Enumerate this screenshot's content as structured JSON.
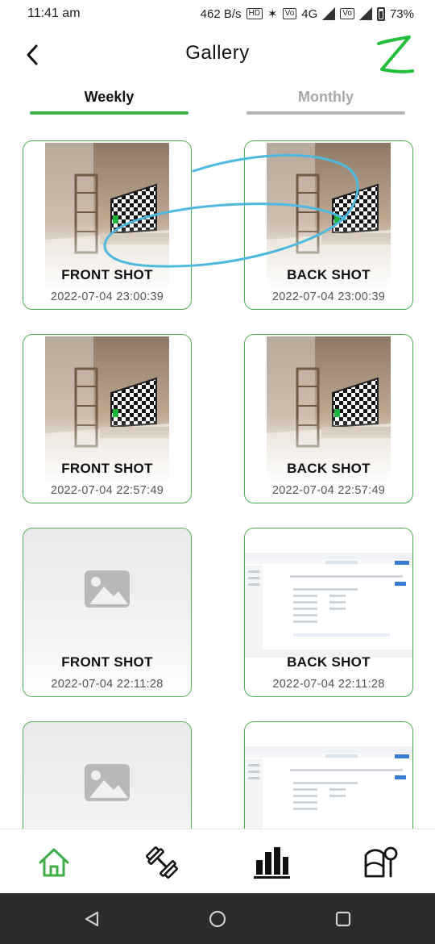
{
  "status": {
    "time": "11:41 am",
    "net_speed": "462 B/s",
    "battery": "73%",
    "network": "4G"
  },
  "header": {
    "title": "Gallery"
  },
  "tabs": [
    {
      "label": "Weekly",
      "active": true
    },
    {
      "label": "Monthly",
      "active": false
    }
  ],
  "cards": [
    {
      "title": "FRONT SHOT",
      "date": "2022-07-04 23:00:39",
      "thumb": "room-photo"
    },
    {
      "title": "BACK SHOT",
      "date": "2022-07-04 23:00:39",
      "thumb": "room-photo"
    },
    {
      "title": "FRONT SHOT",
      "date": "2022-07-04 22:57:49",
      "thumb": "room-photo"
    },
    {
      "title": "BACK SHOT",
      "date": "2022-07-04 22:57:49",
      "thumb": "room-photo"
    },
    {
      "title": "FRONT SHOT",
      "date": "2022-07-04 22:11:28",
      "thumb": "image-placeholder"
    },
    {
      "title": "BACK SHOT",
      "date": "2022-07-04 22:11:28",
      "thumb": "screenshot"
    },
    {
      "title": "",
      "date": "",
      "thumb": "image-placeholder"
    },
    {
      "title": "",
      "date": "",
      "thumb": "screenshot"
    }
  ],
  "bottom_nav": [
    {
      "icon": "home-icon",
      "active": true
    },
    {
      "icon": "dumbbell-icon",
      "active": false
    },
    {
      "icon": "bar-chart-icon",
      "active": false
    },
    {
      "icon": "body-measure-icon",
      "active": false
    }
  ],
  "colors": {
    "accent": "#3fae49",
    "inactive_tab": "#a8a8a8",
    "annotation": "#4db8e0"
  }
}
